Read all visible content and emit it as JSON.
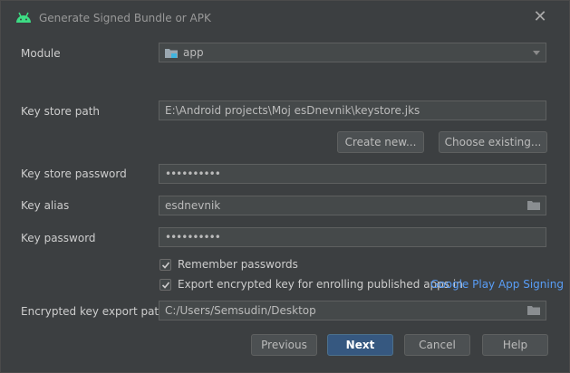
{
  "window": {
    "title": "Generate Signed Bundle or APK",
    "close_icon": "close-icon",
    "app_icon": "android-icon",
    "colors": {
      "background": "#3c3f41",
      "field": "#45494a",
      "primary_button": "#365880",
      "link": "#589df6",
      "android_green": "#3ddc84"
    }
  },
  "module": {
    "label": "Module",
    "value": "app",
    "icon": "module-folder-icon"
  },
  "key_store_path": {
    "label": "Key store path",
    "value": "E:\\Android projects\\Moj esDnevnik\\keystore.jks"
  },
  "key_store_buttons": {
    "create_new": "Create new...",
    "choose_existing": "Choose existing..."
  },
  "key_store_password": {
    "label": "Key store password",
    "value": "••••••••••"
  },
  "key_alias": {
    "label": "Key alias",
    "value": "esdnevnik",
    "icon": "folder-icon"
  },
  "key_password": {
    "label": "Key password",
    "value": "••••••••••"
  },
  "remember_passwords": {
    "label": "Remember passwords",
    "checked": true
  },
  "export_encrypted": {
    "label": "Export encrypted key for enrolling published apps in",
    "checked": true,
    "link": "Google Play App Signing"
  },
  "export_path": {
    "label": "Encrypted key export path",
    "value": "C:/Users/Semsudin/Desktop",
    "icon": "folder-icon"
  },
  "footer": {
    "previous": "Previous",
    "next": "Next",
    "cancel": "Cancel",
    "help": "Help"
  }
}
